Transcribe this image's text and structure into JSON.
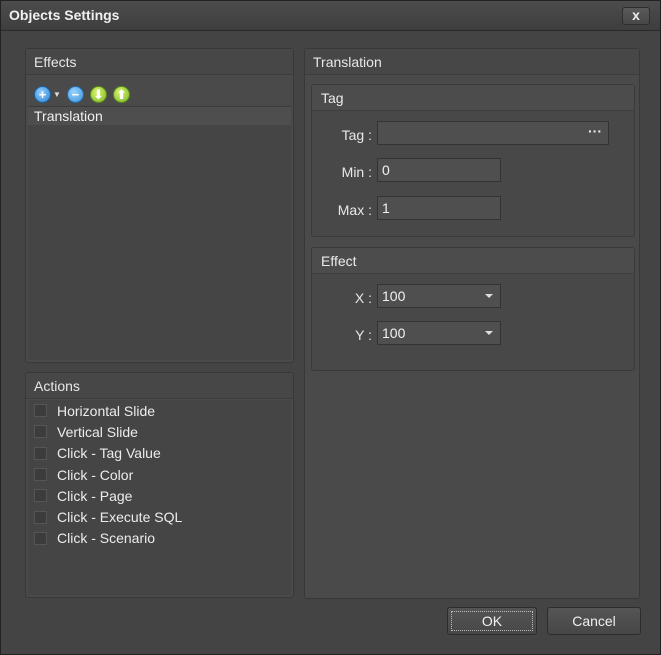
{
  "window": {
    "title": "Objects Settings",
    "close_label": "x"
  },
  "effects": {
    "header": "Effects",
    "toolbar": {
      "add_icon": "add-circle-icon",
      "remove_icon": "remove-circle-icon",
      "down_icon": "move-down-icon",
      "up_icon": "move-up-icon"
    },
    "items": [
      "Translation"
    ]
  },
  "actions": {
    "header": "Actions",
    "items": [
      {
        "label": "Horizontal Slide",
        "checked": false
      },
      {
        "label": "Vertical Slide",
        "checked": false
      },
      {
        "label": "Click - Tag Value",
        "checked": false
      },
      {
        "label": "Click - Color",
        "checked": false
      },
      {
        "label": "Click - Page",
        "checked": false
      },
      {
        "label": "Click - Execute SQL",
        "checked": false
      },
      {
        "label": "Click - Scenario",
        "checked": false
      }
    ]
  },
  "translation": {
    "header": "Translation",
    "tag_panel": {
      "header": "Tag",
      "tag_label": "Tag :",
      "tag_value": "",
      "browse_label": "···",
      "min_label": "Min :",
      "min_value": "0",
      "max_label": "Max :",
      "max_value": "1"
    },
    "effect_panel": {
      "header": "Effect",
      "x_label": "X :",
      "x_value": "100",
      "y_label": "Y :",
      "y_value": "100"
    }
  },
  "buttons": {
    "ok": "OK",
    "cancel": "Cancel"
  }
}
